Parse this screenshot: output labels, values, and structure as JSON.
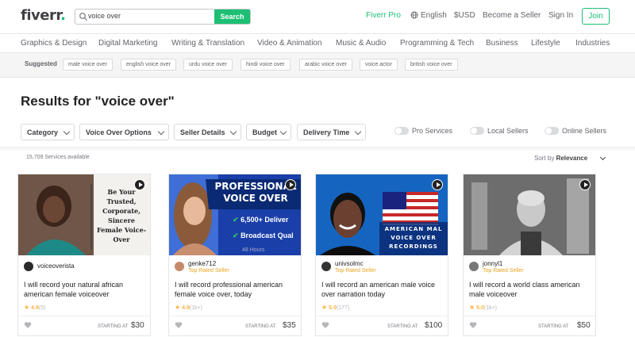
{
  "header": {
    "logo": "fiverr",
    "logo_dot": ".",
    "search_value": "voice over",
    "search_button": "Search",
    "nav": {
      "pro": "Fiverr Pro",
      "language": "English",
      "currency": "$USD",
      "become_seller": "Become a Seller",
      "sign_in": "Sign In",
      "join": "Join"
    }
  },
  "categories": [
    "Graphics & Design",
    "Digital Marketing",
    "Writing & Translation",
    "Video & Animation",
    "Music & Audio",
    "Programming & Tech",
    "Business",
    "Lifestyle",
    "Industries"
  ],
  "suggested": {
    "label": "Suggested",
    "chips": [
      "male voice over",
      "english voice over",
      "urdu voice over",
      "hindi voice over",
      "arabic voice over",
      "voice actor",
      "british voice over"
    ]
  },
  "results_title": "Results for \"voice over\"",
  "filters": [
    "Category",
    "Voice Over Options",
    "Seller Details",
    "Budget",
    "Delivery Time"
  ],
  "toggles": [
    "Pro Services",
    "Local Sellers",
    "Online Sellers"
  ],
  "services_count": "15,709 Services available",
  "sort": {
    "label": "Sort by",
    "value": "Relevance"
  },
  "gigs": [
    {
      "seller": "voiceoverista",
      "level": "",
      "title": "I will record your natural african american female voiceover",
      "score": "4.9",
      "count": "(5)",
      "starting": "STARTING AT",
      "price": "$30",
      "image_text": "Be Your Trusted, Corporate, Sincere Female Voice-Over"
    },
    {
      "seller": "genke712",
      "level": "Top Rated Seller",
      "title": "I will record professional american female voice over, today",
      "score": "4.9",
      "count": "(1k+)",
      "starting": "STARTING AT",
      "price": "$35",
      "image_text": "PROFESSIONAL VOICE OVER",
      "image_bullets": [
        "6,500+ Deliver",
        "Broadcast Qual",
        "48 Hours"
      ]
    },
    {
      "seller": "univsolmc",
      "level": "Top Rated Seller",
      "title": "I will record an american male voice over narration today",
      "score": "5.0",
      "count": "(177)",
      "starting": "STARTING AT",
      "price": "$100",
      "image_text": "AMERICAN MAL VOICE OVER RECORDINGS"
    },
    {
      "seller": "jonnyl1",
      "level": "Top Rated Seller",
      "title": "I will record a world class american male voiceover",
      "score": "5.0",
      "count": "(1k+)",
      "starting": "STARTING AT",
      "price": "$50",
      "image_text": ""
    }
  ],
  "colors": {
    "brand": "#1dbf73",
    "star": "#ffb33e",
    "level": "#e8a520"
  }
}
